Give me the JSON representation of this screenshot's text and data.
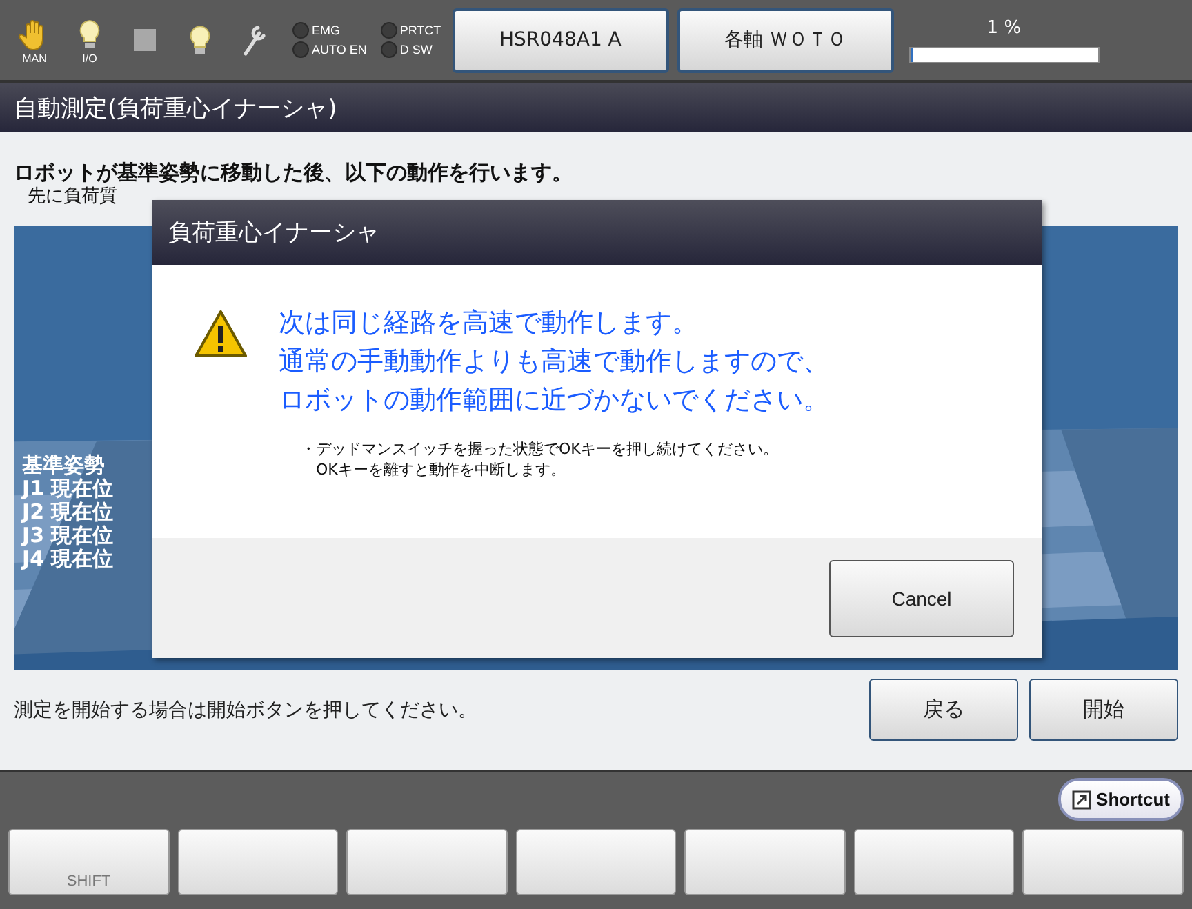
{
  "toolbar": {
    "icons": [
      {
        "kind": "hand",
        "label": "MAN"
      },
      {
        "kind": "bulb",
        "label": "I/O"
      },
      {
        "kind": "square"
      },
      {
        "kind": "bulb"
      },
      {
        "kind": "wrench"
      }
    ],
    "lamps": [
      {
        "label": "EMG",
        "on": false
      },
      {
        "label": "PRTCT",
        "on": false
      },
      {
        "label": "AUTO EN",
        "on": false
      },
      {
        "label": "D SW",
        "on": false
      }
    ],
    "buttons": [
      "HSR048A1 A",
      "各軸 ＷＯＴＯ"
    ],
    "progress": {
      "reading": "1 %",
      "level": 0.01
    }
  },
  "screen_title": "自動測定(負荷重心イナーシャ)",
  "instructions": [
    "ロボットが基準姿勢に移動した後、以下の動作を行います。",
    "先に負荷質"
  ],
  "view": {
    "lines": [
      "基準姿勢",
      "J1 現在位",
      "J2 現在位",
      "J3 現在位",
      "J4 現在位"
    ]
  },
  "footer": {
    "message": "測定を開始する場合は開始ボタンを押してください。",
    "buttons": [
      "戻る",
      "開始"
    ]
  },
  "dialog": {
    "title": "負荷重心イナーシャ",
    "warning": [
      "次は同じ経路を高速で動作します。",
      "通常の手動動作よりも高速で動作しますので、",
      "ロボットの動作範囲に近づかないでください。"
    ],
    "notes": [
      "・デッドマンスイッチを握った状態でOKキーを押し続けてください。",
      "　OKキーを離すと動作を中断します。"
    ],
    "button": "Cancel"
  },
  "shortcut": "Shortcut",
  "function_keys": [
    {
      "kind": "labeled",
      "label": "SHIFT"
    },
    {
      "kind": "blank"
    },
    {
      "kind": "blank"
    },
    {
      "kind": "blank"
    },
    {
      "kind": "blank"
    },
    {
      "kind": "blank"
    },
    {
      "kind": "blank"
    }
  ]
}
